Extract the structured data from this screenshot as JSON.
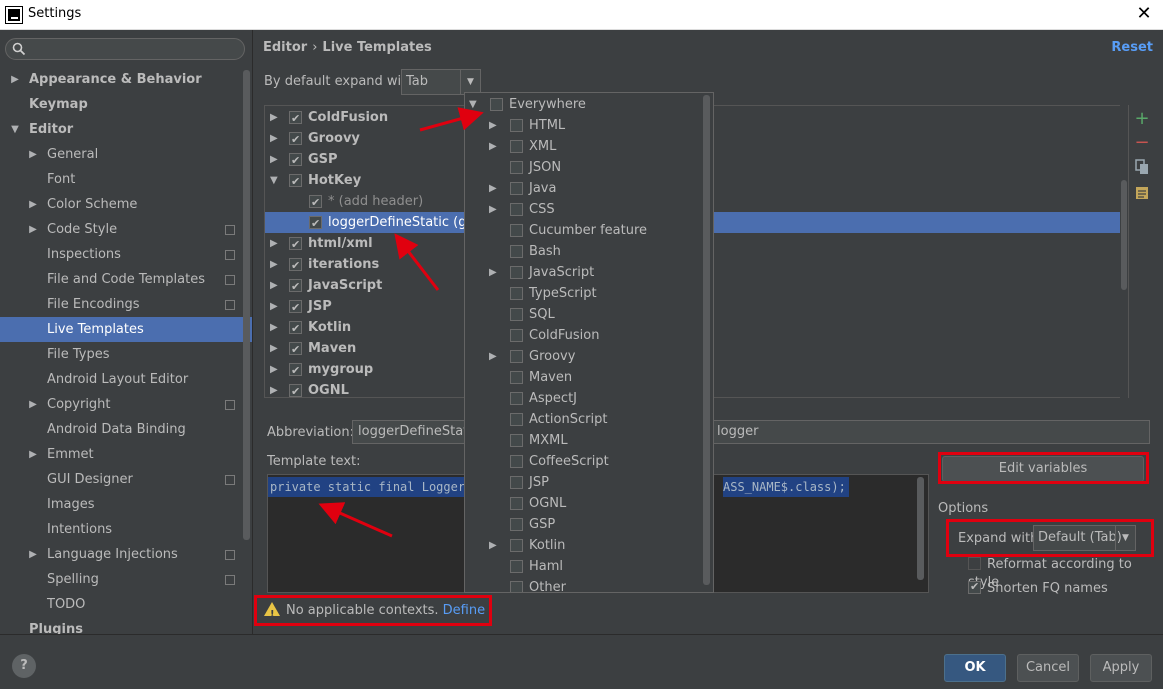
{
  "window": {
    "title": "Settings"
  },
  "sidebar": {
    "items": [
      {
        "label": "Appearance & Behavior",
        "level": 0,
        "arrow": "right",
        "bold": true
      },
      {
        "label": "Keymap",
        "level": 0,
        "arrow": "",
        "bold": true
      },
      {
        "label": "Editor",
        "level": 0,
        "arrow": "down",
        "bold": true
      },
      {
        "label": "General",
        "level": 1,
        "arrow": "right"
      },
      {
        "label": "Font",
        "level": 1,
        "arrow": ""
      },
      {
        "label": "Color Scheme",
        "level": 1,
        "arrow": "right"
      },
      {
        "label": "Code Style",
        "level": 1,
        "arrow": "right",
        "project": true
      },
      {
        "label": "Inspections",
        "level": 1,
        "arrow": "",
        "project": true
      },
      {
        "label": "File and Code Templates",
        "level": 1,
        "arrow": "",
        "project": true
      },
      {
        "label": "File Encodings",
        "level": 1,
        "arrow": "",
        "project": true
      },
      {
        "label": "Live Templates",
        "level": 1,
        "arrow": "",
        "selected": true
      },
      {
        "label": "File Types",
        "level": 1,
        "arrow": ""
      },
      {
        "label": "Android Layout Editor",
        "level": 1,
        "arrow": ""
      },
      {
        "label": "Copyright",
        "level": 1,
        "arrow": "right",
        "project": true
      },
      {
        "label": "Android Data Binding",
        "level": 1,
        "arrow": ""
      },
      {
        "label": "Emmet",
        "level": 1,
        "arrow": "right"
      },
      {
        "label": "GUI Designer",
        "level": 1,
        "arrow": "",
        "project": true
      },
      {
        "label": "Images",
        "level": 1,
        "arrow": ""
      },
      {
        "label": "Intentions",
        "level": 1,
        "arrow": ""
      },
      {
        "label": "Language Injections",
        "level": 1,
        "arrow": "right",
        "project": true
      },
      {
        "label": "Spelling",
        "level": 1,
        "arrow": "",
        "project": true
      },
      {
        "label": "TODO",
        "level": 1,
        "arrow": ""
      },
      {
        "label": "Plugins",
        "level": 0,
        "arrow": "",
        "bold": true
      }
    ]
  },
  "header": {
    "breadcrumb_parent": "Editor",
    "breadcrumb_sep": "›",
    "breadcrumb_current": "Live Templates",
    "reset_label": "Reset"
  },
  "expand": {
    "label": "By default expand with",
    "value": "Tab"
  },
  "templates": [
    {
      "label": "ColdFusion",
      "group": true,
      "checked": true,
      "arrow": "right"
    },
    {
      "label": "Groovy",
      "group": true,
      "checked": true,
      "arrow": "right"
    },
    {
      "label": "GSP",
      "group": true,
      "checked": true,
      "arrow": "right"
    },
    {
      "label": "HotKey",
      "group": true,
      "checked": true,
      "arrow": "down"
    },
    {
      "label": "* (add header)",
      "group": false,
      "checked": true,
      "dim": true
    },
    {
      "label": "loggerDefineStatic (get",
      "group": false,
      "checked": true,
      "selected": true
    },
    {
      "label": "html/xml",
      "group": true,
      "checked": true,
      "arrow": "right"
    },
    {
      "label": "iterations",
      "group": true,
      "checked": true,
      "arrow": "right"
    },
    {
      "label": "JavaScript",
      "group": true,
      "checked": true,
      "arrow": "right"
    },
    {
      "label": "JSP",
      "group": true,
      "checked": true,
      "arrow": "right"
    },
    {
      "label": "Kotlin",
      "group": true,
      "checked": true,
      "arrow": "right"
    },
    {
      "label": "Maven",
      "group": true,
      "checked": true,
      "arrow": "right"
    },
    {
      "label": "mygroup",
      "group": true,
      "checked": true,
      "arrow": "right"
    },
    {
      "label": "OGNL",
      "group": true,
      "checked": true,
      "arrow": "right"
    }
  ],
  "context_popup": [
    {
      "label": "Everywhere",
      "arrow": "down",
      "indent": 0
    },
    {
      "label": "HTML",
      "arrow": "right",
      "indent": 1
    },
    {
      "label": "XML",
      "arrow": "right",
      "indent": 1
    },
    {
      "label": "JSON",
      "arrow": "",
      "indent": 1
    },
    {
      "label": "Java",
      "arrow": "right",
      "indent": 1
    },
    {
      "label": "CSS",
      "arrow": "right",
      "indent": 1
    },
    {
      "label": "Cucumber feature",
      "arrow": "",
      "indent": 1
    },
    {
      "label": "Bash",
      "arrow": "",
      "indent": 1
    },
    {
      "label": "JavaScript",
      "arrow": "right",
      "indent": 1
    },
    {
      "label": "TypeScript",
      "arrow": "",
      "indent": 1
    },
    {
      "label": "SQL",
      "arrow": "",
      "indent": 1
    },
    {
      "label": "ColdFusion",
      "arrow": "",
      "indent": 1
    },
    {
      "label": "Groovy",
      "arrow": "right",
      "indent": 1
    },
    {
      "label": "Maven",
      "arrow": "",
      "indent": 1
    },
    {
      "label": "AspectJ",
      "arrow": "",
      "indent": 1
    },
    {
      "label": "ActionScript",
      "arrow": "",
      "indent": 1
    },
    {
      "label": "MXML",
      "arrow": "",
      "indent": 1
    },
    {
      "label": "CoffeeScript",
      "arrow": "",
      "indent": 1
    },
    {
      "label": "JSP",
      "arrow": "",
      "indent": 1
    },
    {
      "label": "OGNL",
      "arrow": "",
      "indent": 1
    },
    {
      "label": "GSP",
      "arrow": "",
      "indent": 1
    },
    {
      "label": "Kotlin",
      "arrow": "right",
      "indent": 1
    },
    {
      "label": "Haml",
      "arrow": "",
      "indent": 1
    },
    {
      "label": "Other",
      "arrow": "",
      "indent": 1
    }
  ],
  "editor": {
    "abbreviation_label": "Abbreviation:",
    "abbreviation_value": "loggerDefineStatic",
    "description_value": "logger",
    "template_text_label": "Template text:",
    "template_text_start": "private static final Logger ",
    "template_text_end": "ASS_NAME$.class);",
    "edit_variables_label": "Edit variables"
  },
  "options": {
    "label": "Options",
    "expand_with_label": "Expand with",
    "expand_with_value": "Default (Tab)",
    "reformat_label": "Reformat according to style",
    "reformat_checked": false,
    "shorten_label": "Shorten FQ names",
    "shorten_checked": true
  },
  "warning": {
    "text": "No applicable contexts.",
    "link": "Define"
  },
  "footer": {
    "help": "?",
    "ok": "OK",
    "cancel": "Cancel",
    "apply": "Apply"
  }
}
